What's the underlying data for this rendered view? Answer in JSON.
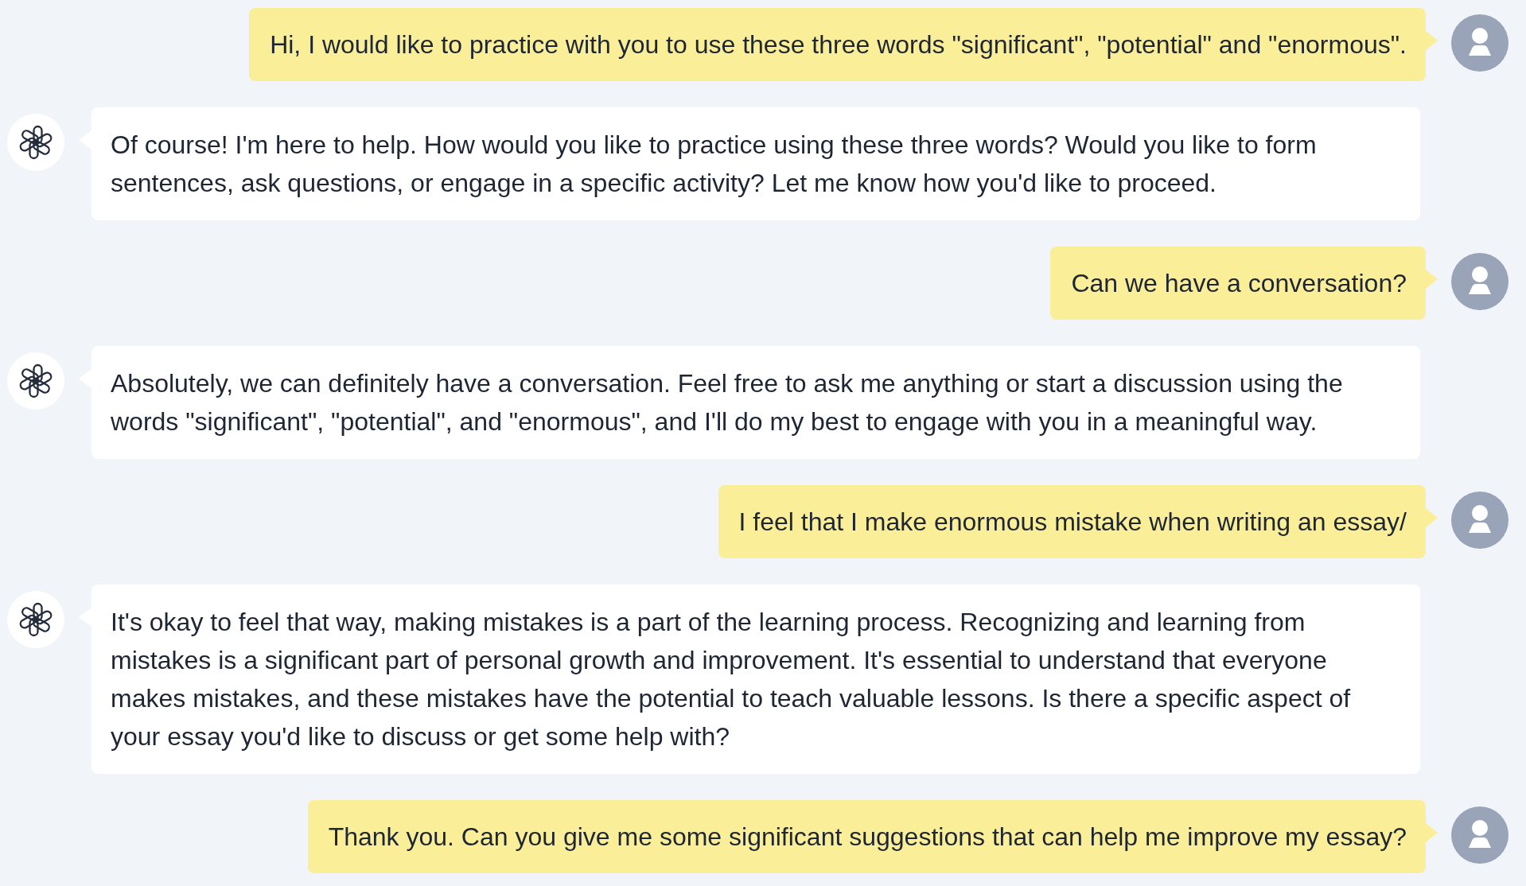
{
  "messages": [
    {
      "kind": "user",
      "text": "Hi, I would like to practice with you to use these three words \"significant\", \"potential\" and \"enormous\"."
    },
    {
      "kind": "assistant",
      "text": "Of course! I'm here to help. How would you like to practice using these three words? Would you like to form sentences, ask questions, or engage in a specific activity? Let me know how you'd like to proceed."
    },
    {
      "kind": "user",
      "text": "Can we have a conversation?"
    },
    {
      "kind": "assistant",
      "text": "Absolutely, we can definitely have a conversation. Feel free to ask me anything or start a discussion using the words \"significant\", \"potential\", and \"enormous\", and I'll do my best to engage with you in a meaningful way."
    },
    {
      "kind": "user",
      "text": "I feel that I make enormous mistake when writing an essay/"
    },
    {
      "kind": "assistant",
      "text": "It's okay to feel that way, making mistakes is a part of the learning process. Recognizing and learning from mistakes is a significant part of personal growth and improvement. It's essential to understand that everyone makes mistakes, and these mistakes have the potential to teach valuable lessons. Is there a specific aspect of your essay you'd like to discuss or get some help with?"
    },
    {
      "kind": "user",
      "text": "Thank you. Can you give me some significant suggestions that can help me improve my essay?"
    }
  ]
}
